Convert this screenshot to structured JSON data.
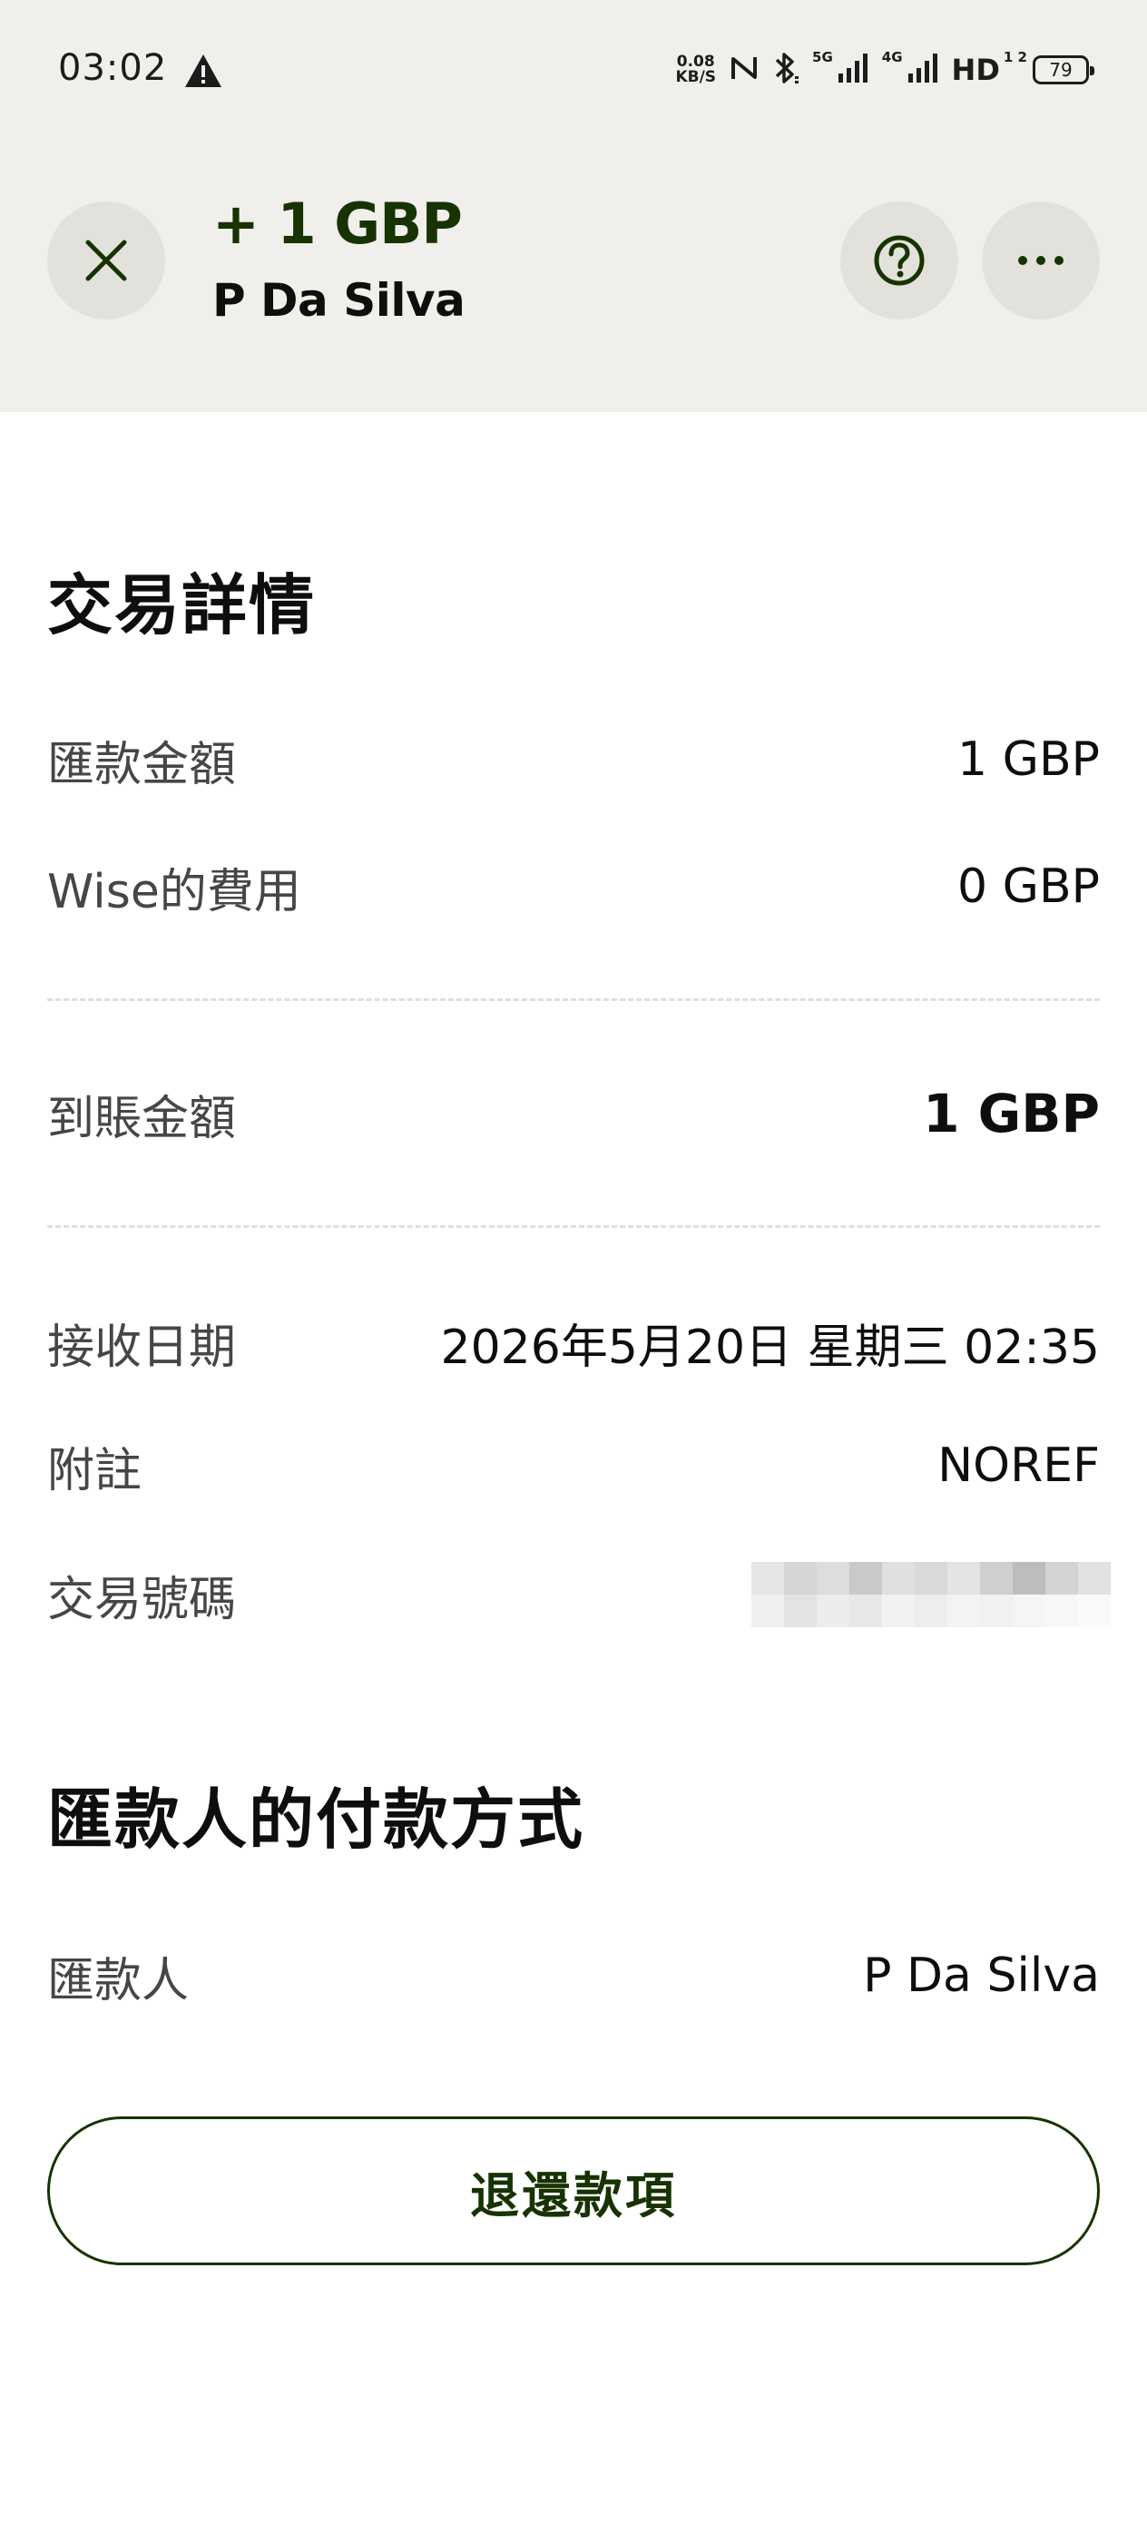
{
  "status_bar": {
    "time": "03:02",
    "warning_icon": "warning-triangle-icon",
    "net_speed_value": "0.08",
    "net_speed_unit": "KB/S",
    "signal_5g_label": "5G",
    "signal_4g_label": "4G",
    "hd_label": "HD",
    "hd_sub": "1 2",
    "battery_level": "79"
  },
  "header": {
    "close_icon": "close-icon",
    "amount": "+ 1 GBP",
    "name": "P Da Silva",
    "help_icon": "help-icon",
    "more_icon": "more-icon",
    "brand_color": "#163300"
  },
  "transaction_details": {
    "title": "交易詳情",
    "rows": [
      {
        "label": "匯款金額",
        "value": "1 GBP"
      },
      {
        "label": "Wise的費用",
        "value": "0 GBP"
      },
      {
        "label": "到賬金額",
        "value": "1 GBP"
      },
      {
        "label": "接收日期",
        "value": "2026年5月20日 星期三 02:35"
      },
      {
        "label": "附註",
        "value": "NOREF"
      },
      {
        "label": "交易號碼",
        "value": ""
      }
    ]
  },
  "payer_method": {
    "title": "匯款人的付款方式",
    "rows": [
      {
        "label": "匯款人",
        "value": "P Da Silva"
      }
    ]
  },
  "actions": {
    "refund_label": "退還款項"
  }
}
